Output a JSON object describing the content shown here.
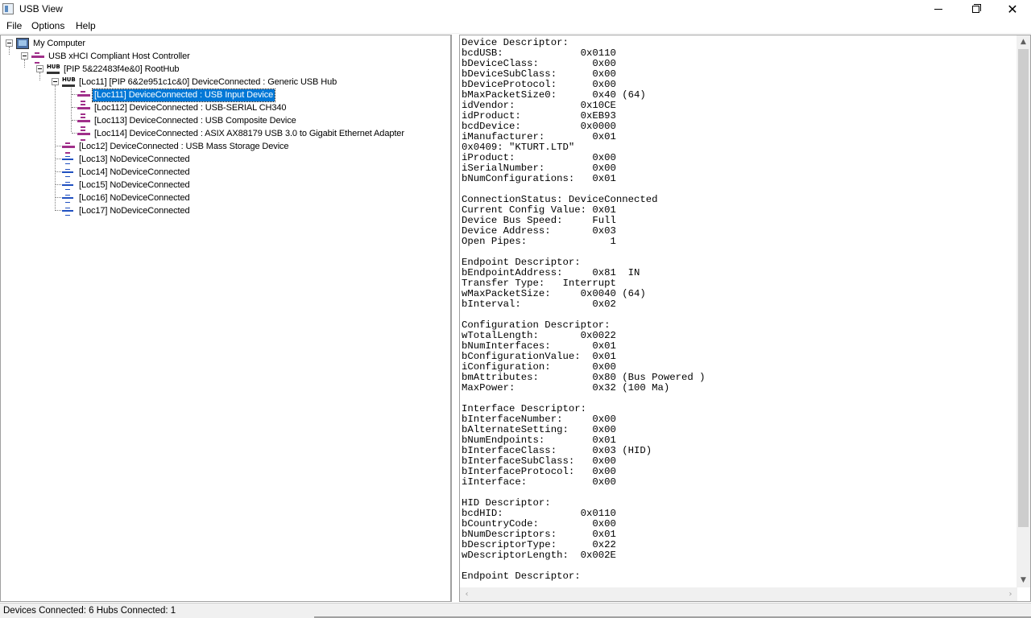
{
  "window": {
    "title": "USB View"
  },
  "menu": {
    "file": "File",
    "options": "Options",
    "help": "Help"
  },
  "tree": {
    "my_computer": "My Computer",
    "host_controller": "USB xHCI Compliant Host Controller",
    "root_hub": "[PIP 5&22483f4e&0] RootHub",
    "hub_icon_text": "HUB",
    "generic_hub": "[Loc11] [PIP 6&2e951c1c&0] DeviceConnected :  Generic USB Hub",
    "loc111": "[Loc111] DeviceConnected :  USB Input Device",
    "loc112": "[Loc112] DeviceConnected :  USB-SERIAL CH340",
    "loc113": "[Loc113] DeviceConnected :  USB Composite Device",
    "loc114": "[Loc114] DeviceConnected :  ASIX AX88179 USB 3.0 to Gigabit Ethernet Adapter",
    "loc12": "[Loc12] DeviceConnected :  USB Mass Storage Device",
    "loc13": "[Loc13] NoDeviceConnected",
    "loc14": "[Loc14] NoDeviceConnected",
    "loc15": "[Loc15] NoDeviceConnected",
    "loc16": "[Loc16] NoDeviceConnected",
    "loc17": "[Loc17] NoDeviceConnected"
  },
  "details": {
    "text": "Device Descriptor:\nbcdUSB:             0x0110\nbDeviceClass:         0x00\nbDeviceSubClass:      0x00\nbDeviceProtocol:      0x00\nbMaxPacketSize0:      0x40 (64)\nidVendor:           0x10CE\nidProduct:          0xEB93\nbcdDevice:          0x0000\niManufacturer:        0x01\n0x0409: \"KTURT.LTD\"\niProduct:             0x00\niSerialNumber:        0x00\nbNumConfigurations:   0x01\n\nConnectionStatus: DeviceConnected\nCurrent Config Value: 0x01\nDevice Bus Speed:     Full\nDevice Address:       0x03\nOpen Pipes:              1\n\nEndpoint Descriptor:\nbEndpointAddress:     0x81  IN\nTransfer Type:   Interrupt\nwMaxPacketSize:     0x0040 (64)\nbInterval:            0x02\n\nConfiguration Descriptor:\nwTotalLength:       0x0022\nbNumInterfaces:       0x01\nbConfigurationValue:  0x01\niConfiguration:       0x00\nbmAttributes:         0x80 (Bus Powered )\nMaxPower:             0x32 (100 Ma)\n\nInterface Descriptor:\nbInterfaceNumber:     0x00\nbAlternateSetting:    0x00\nbNumEndpoints:        0x01\nbInterfaceClass:      0x03 (HID)\nbInterfaceSubClass:   0x00\nbInterfaceProtocol:   0x00\niInterface:           0x00\n\nHID Descriptor:\nbcdHID:             0x0110\nbCountryCode:         0x00\nbNumDescriptors:      0x01\nbDescriptorType:      0x22\nwDescriptorLength:  0x002E\n\nEndpoint Descriptor:"
  },
  "status": {
    "text": "Devices Connected: 6   Hubs Connected: 1"
  },
  "icons": {
    "minimize": "minimize-icon",
    "maximize": "restore-icon",
    "close": "close-icon"
  }
}
